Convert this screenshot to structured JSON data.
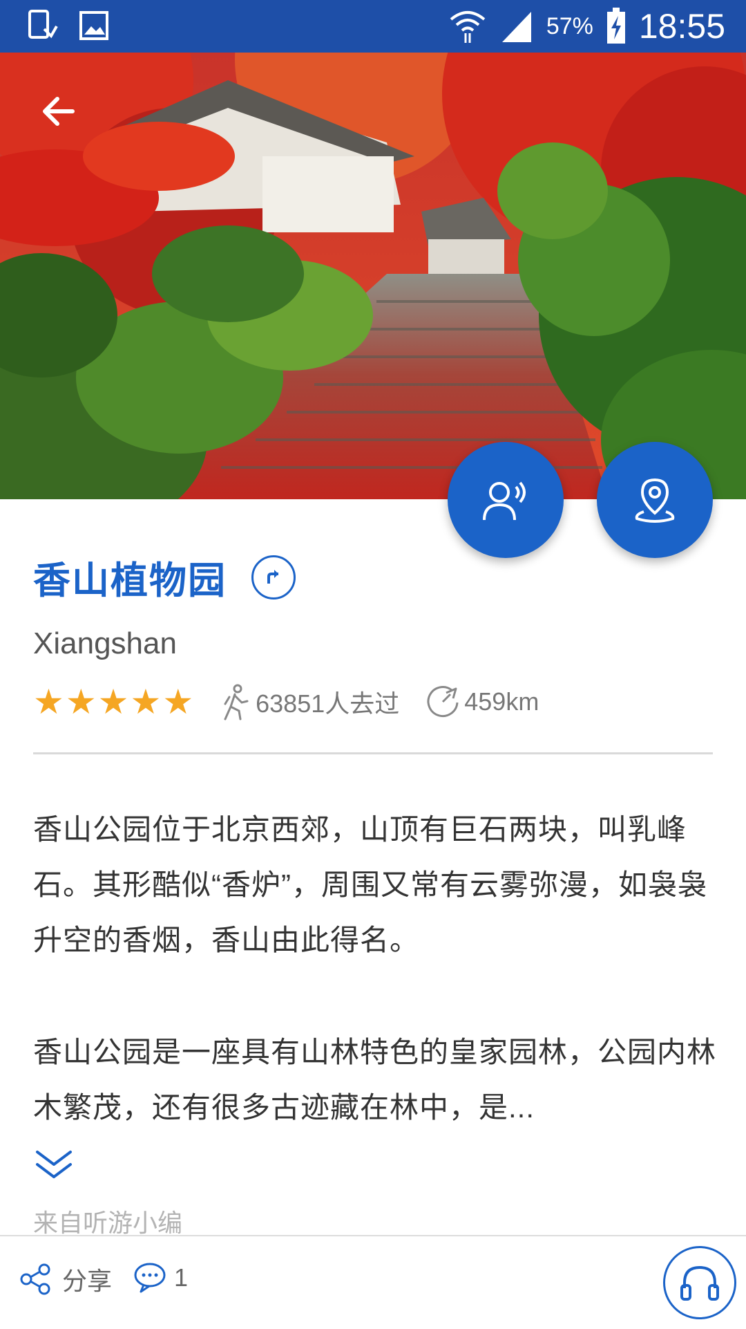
{
  "status_bar": {
    "battery": "57%",
    "time": "18:55",
    "icons": [
      "download-notification-icon",
      "gallery-notification-icon",
      "wifi-icon",
      "signal-icon",
      "battery-charging-icon"
    ]
  },
  "hero": {
    "image_description_icon": "autumn-maple-stairs-photo",
    "back_icon": "arrow-left-icon"
  },
  "fabs": {
    "guide_icon": "voice-guide-icon",
    "location_icon": "map-pin-icon"
  },
  "place": {
    "name": "香山植物园",
    "subtitle": "Xiangshan",
    "rating": 5,
    "visitors": "63851人去过",
    "distance": "459km"
  },
  "description": {
    "paragraph1": "香山公园位于北京西郊，山顶有巨石两块，叫乳峰石。其形酷似“香炉”，周围又常有云雾弥漫，如袅袅升空的香烟，香山由此得名。",
    "paragraph2": "香山公园是一座具有山林特色的皇家园林，公园内林木繁茂，还有很多古迹藏在林中，是...",
    "source": "来自听游小编"
  },
  "bottom_bar": {
    "share_label": "分享",
    "comment_count": "1"
  },
  "colors": {
    "primary": "#1b63c8",
    "status_bar": "#1e4fa8",
    "star": "#f5a623"
  }
}
